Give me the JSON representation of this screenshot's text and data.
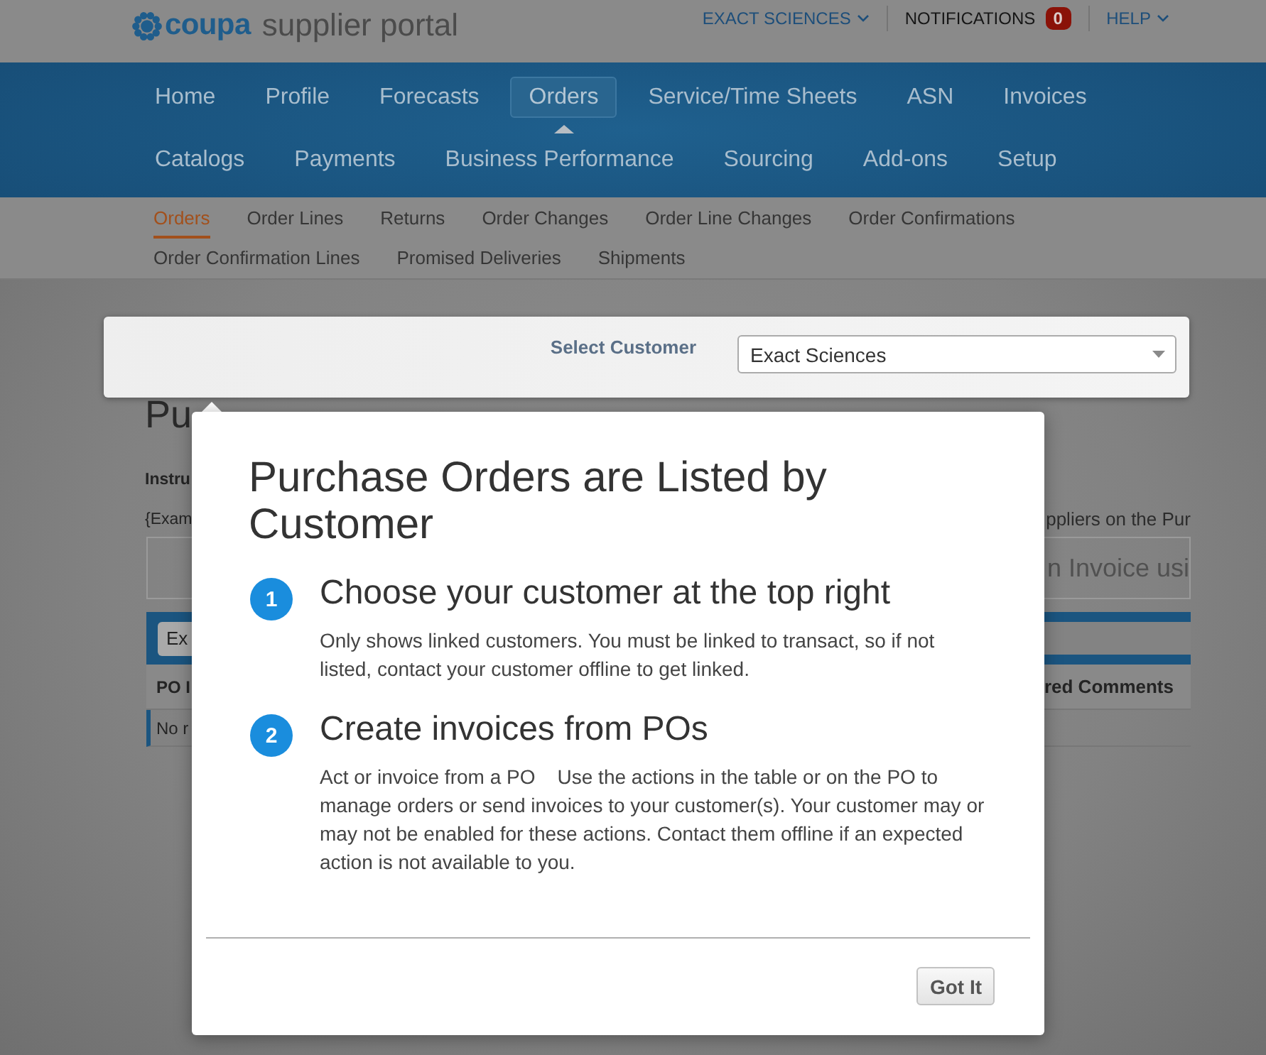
{
  "header": {
    "logo": {
      "brand": "coupa",
      "product": "supplier portal"
    },
    "account_menu": {
      "label": "EXACT SCIENCES"
    },
    "notifications": {
      "label": "NOTIFICATIONS",
      "count": "0"
    },
    "help_menu": {
      "label": "HELP"
    }
  },
  "main_nav": {
    "items": [
      {
        "label": "Home",
        "selected": false
      },
      {
        "label": "Profile",
        "selected": false
      },
      {
        "label": "Forecasts",
        "selected": false
      },
      {
        "label": "Orders",
        "selected": true
      },
      {
        "label": "Service/Time Sheets",
        "selected": false
      },
      {
        "label": "ASN",
        "selected": false
      },
      {
        "label": "Invoices",
        "selected": false
      },
      {
        "label": "Catalogs",
        "selected": false
      },
      {
        "label": "Payments",
        "selected": false
      },
      {
        "label": "Business Performance",
        "selected": false
      },
      {
        "label": "Sourcing",
        "selected": false
      },
      {
        "label": "Add-ons",
        "selected": false
      },
      {
        "label": "Setup",
        "selected": false
      }
    ]
  },
  "sub_nav": {
    "items": [
      {
        "label": "Orders",
        "selected": true
      },
      {
        "label": "Order Lines",
        "selected": false
      },
      {
        "label": "Returns",
        "selected": false
      },
      {
        "label": "Order Changes",
        "selected": false
      },
      {
        "label": "Order Line Changes",
        "selected": false
      },
      {
        "label": "Order Confirmations",
        "selected": false
      },
      {
        "label": "Order Confirmation Lines",
        "selected": false
      },
      {
        "label": "Promised Deliveries",
        "selected": false
      },
      {
        "label": "Shipments",
        "selected": false
      }
    ]
  },
  "customer_selector": {
    "label": "Select Customer",
    "value": "Exact Sciences"
  },
  "page": {
    "title": "Pu",
    "instructions_heading": "Instru",
    "instructions_left": "{Exam",
    "instructions_right": "ppliers on the Pur",
    "banner_text": "n Invoice usi",
    "toolbar_button": "Ex",
    "table": {
      "columns": [
        "PO I",
        "red Comments"
      ],
      "rows": [
        [
          "No r"
        ]
      ]
    }
  },
  "dialog": {
    "title": "Purchase Orders are Listed by Customer",
    "steps": [
      {
        "number": "1",
        "title": "Choose your customer at the top right",
        "text": "Only shows linked customers. You must be linked to transact, so if not listed, contact your customer offline to get linked."
      },
      {
        "number": "2",
        "title": "Create invoices from POs",
        "text": "Act or invoice from a PO    Use the actions in the table or on the PO to manage orders or send invoices to your customer(s). Your customer may or may not be enabled for these actions. Contact them offline if an expected action is not available to you."
      }
    ],
    "button": "Got It"
  }
}
